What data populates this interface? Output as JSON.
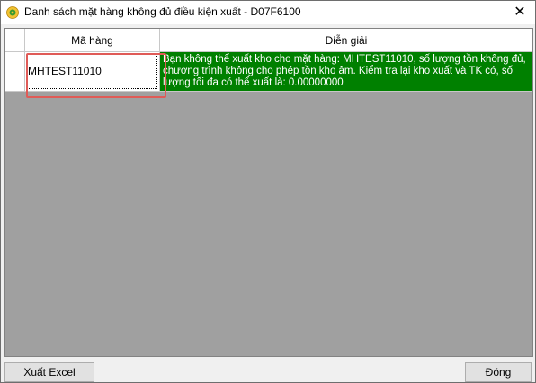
{
  "window": {
    "title": "Danh sách mặt hàng không đủ điều kiện xuất - D07F6100",
    "close_glyph": "✕"
  },
  "grid": {
    "columns": [
      "Mã hàng",
      "Diễn giải"
    ],
    "rows": [
      {
        "ma_hang": "MHTEST11010",
        "dien_giai": "Bạn không thể xuất kho cho mặt hàng: MHTEST11010, số lượng tồn không đủ, chương trình không cho phép tồn kho âm. Kiểm tra lại kho xuất và TK có, số lượng tối đa có thể xuất là: 0.00000000"
      }
    ],
    "row_background": "#008000",
    "empty_background": "#a0a0a0"
  },
  "buttons": {
    "export_excel": "Xuất Excel",
    "close": "Đóng"
  },
  "icons": {
    "app": "app-logo-icon",
    "close": "close-icon"
  },
  "colors": {
    "highlight": "#e05b57"
  }
}
